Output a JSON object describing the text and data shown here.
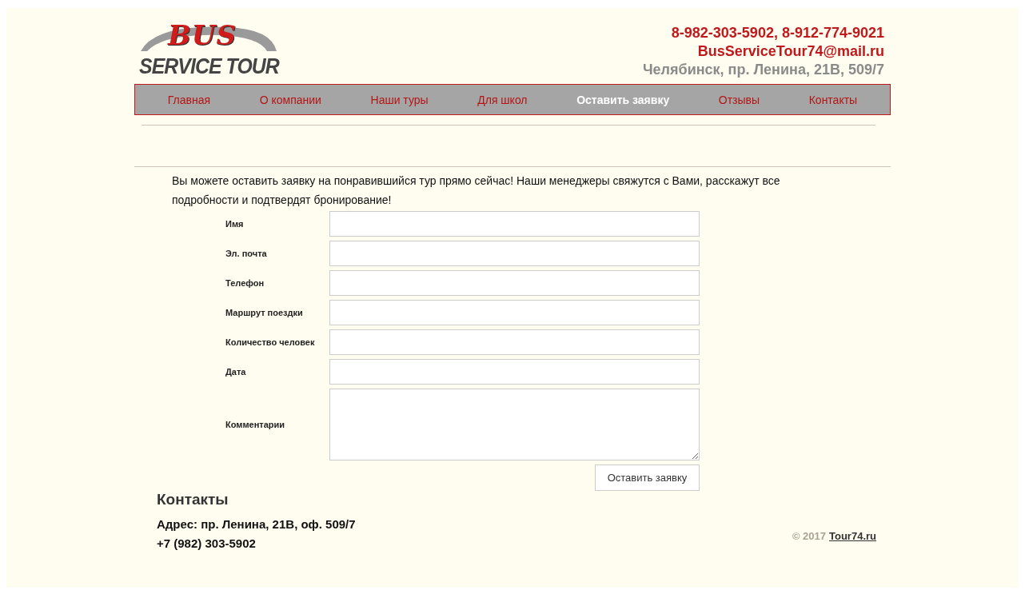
{
  "logo": {
    "line_1": "BUS",
    "line_2": "SERVICE TOUR"
  },
  "header_contacts": {
    "phones": "8-982-303-5902, 8-912-774-9021",
    "email": "BusServiceTour74@mail.ru",
    "address": "Челябинск, пр. Ленина, 21В, 509/7"
  },
  "nav": [
    {
      "label": "Главная",
      "selected": false
    },
    {
      "label": "О компании",
      "selected": false
    },
    {
      "label": "Наши туры",
      "selected": false
    },
    {
      "label": "Для школ",
      "selected": false
    },
    {
      "label": "Оставить заявку",
      "selected": true
    },
    {
      "label": "Отзывы",
      "selected": false
    },
    {
      "label": "Контакты",
      "selected": false
    }
  ],
  "intro": "Вы можете оставить заявку на понравившийся тур прямо сейчас! Наши менеджеры свяжутся с Вами, расскажут все подробности и подтвердят бронирование!",
  "form": {
    "fields": [
      {
        "label": "Имя",
        "kind": "input"
      },
      {
        "label": "Эл. почта",
        "kind": "input"
      },
      {
        "label": "Телефон",
        "kind": "input"
      },
      {
        "label": "Маршрут поездки",
        "kind": "input"
      },
      {
        "label": "Количество человек",
        "kind": "input"
      },
      {
        "label": "Дата",
        "kind": "input"
      },
      {
        "label": "Комментарии",
        "kind": "textarea"
      }
    ],
    "submit": "Оставить заявку"
  },
  "footer": {
    "title": "Контакты",
    "address": "Адрес: пр. Ленина, 21В, оф. 509/7",
    "phone": "+7 (982) 303-5902",
    "copyright": "© 2017",
    "site_link": "Tour74.ru"
  }
}
